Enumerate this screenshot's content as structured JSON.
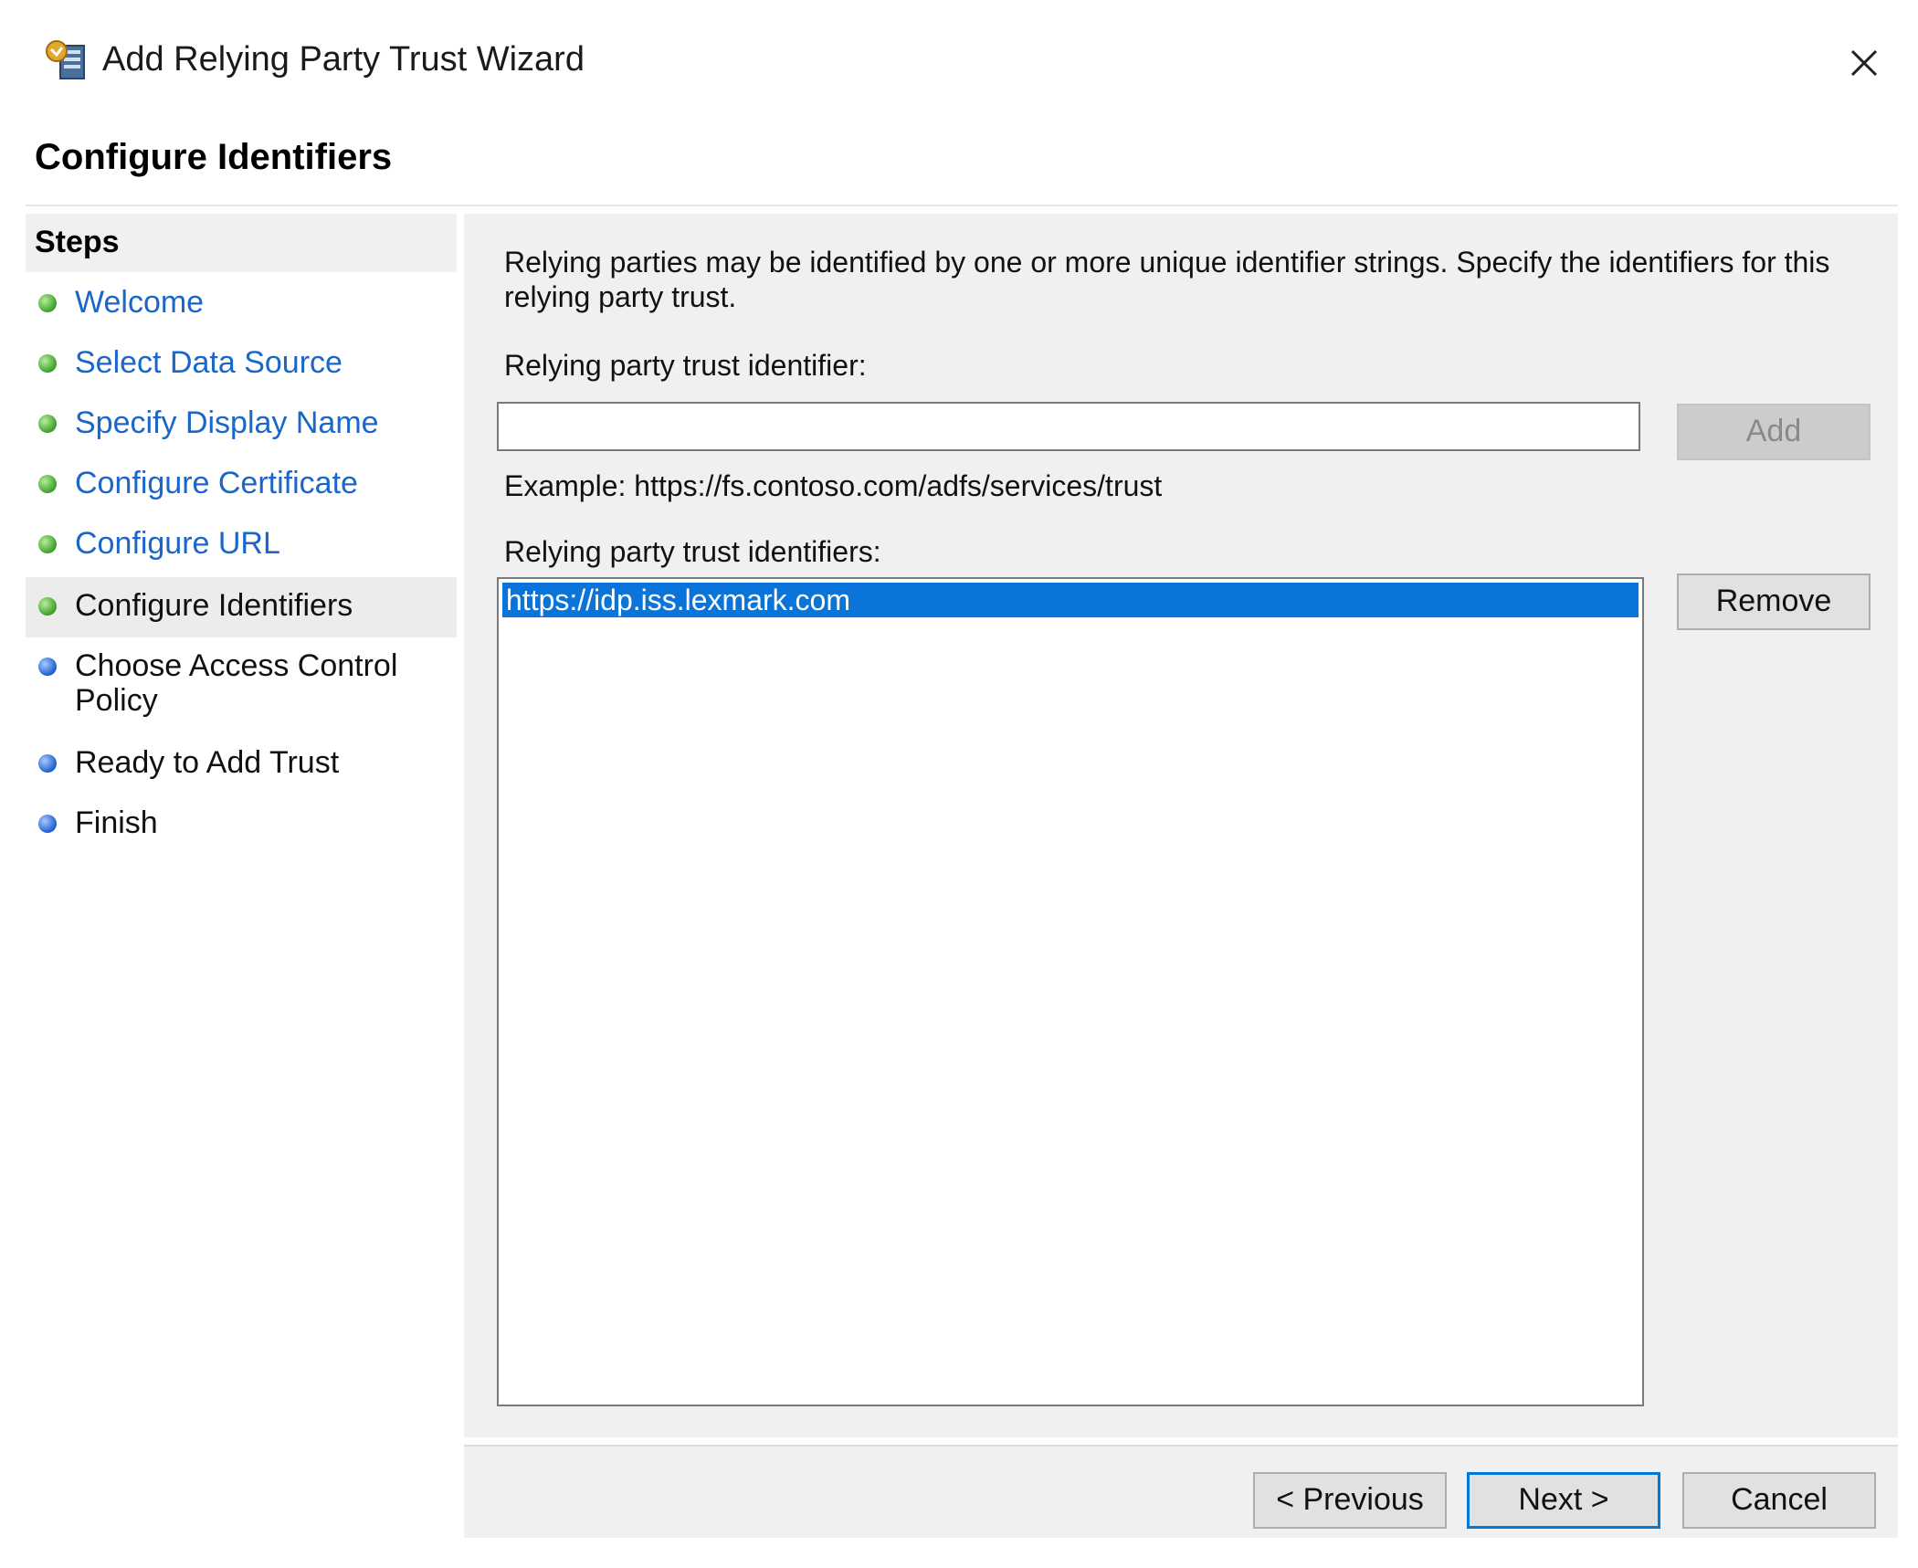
{
  "window": {
    "title": "Add Relying Party Trust Wizard",
    "icon": "server-trust-icon",
    "close_icon": "close-icon"
  },
  "page": {
    "title": "Configure Identifiers"
  },
  "steps": {
    "header": "Steps",
    "items": [
      {
        "label": "Welcome",
        "state": "done"
      },
      {
        "label": "Select Data Source",
        "state": "done"
      },
      {
        "label": "Specify Display Name",
        "state": "done"
      },
      {
        "label": "Configure Certificate",
        "state": "done"
      },
      {
        "label": "Configure URL",
        "state": "done"
      },
      {
        "label": "Configure Identifiers",
        "state": "current"
      },
      {
        "label": "Choose Access Control Policy",
        "label_line1": "Choose Access Control",
        "label_line2": "Policy",
        "state": "pending"
      },
      {
        "label": "Ready to Add Trust",
        "state": "pending"
      },
      {
        "label": "Finish",
        "state": "pending"
      }
    ]
  },
  "content": {
    "instructions": "Relying parties may be identified by one or more unique identifier strings. Specify the identifiers for this relying party trust.",
    "identifier_label": "Relying party trust identifier:",
    "identifier_value": "",
    "add_button": "Add",
    "example": "Example: https://fs.contoso.com/adfs/services/trust",
    "identifiers_label": "Relying party trust identifiers:",
    "identifiers": [
      "https://idp.iss.lexmark.com"
    ],
    "remove_button": "Remove"
  },
  "footer": {
    "previous_button": "< Previous",
    "next_button": "Next >",
    "cancel_button": "Cancel"
  },
  "colors": {
    "link": "#1b66c9",
    "selection": "#0a74d8",
    "done_dot": "#3ca028",
    "pending_dot": "#1d5fd0",
    "panel_background": "#f0f0f0"
  }
}
